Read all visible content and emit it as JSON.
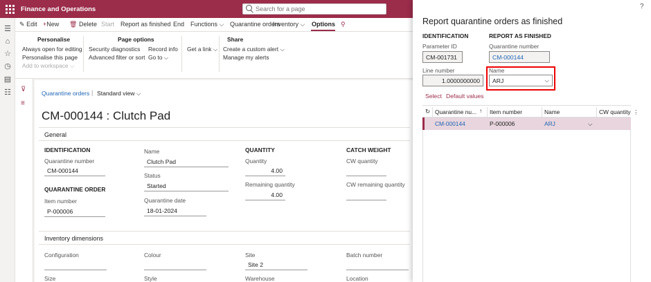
{
  "app": {
    "title": "Finance and Operations",
    "search_placeholder": "Search for a page"
  },
  "actions": {
    "edit": "Edit",
    "new": "New",
    "delete": "Delete",
    "start": "Start",
    "report": "Report as finished",
    "end": "End",
    "functions": "Functions",
    "quarantine_orders": "Quarantine orders",
    "inventory": "Inventory",
    "options": "Options"
  },
  "ribbon": {
    "personalise": {
      "title": "Personalise",
      "items": [
        "Always open for editing",
        "Personalise this page",
        "Add to workspace"
      ]
    },
    "page_options": {
      "title": "Page options",
      "items": [
        "Security diagnostics",
        "Advanced filter or sort",
        "Record info",
        "Go to"
      ]
    },
    "get_link": "Get a link",
    "share": {
      "title": "Share",
      "items": [
        "Create a custom alert",
        "Manage my alerts"
      ]
    }
  },
  "main": {
    "breadcrumb": "Quarantine orders",
    "view": "Standard view",
    "record_title": "CM-000144 : Clutch Pad",
    "general_title": "General",
    "identification": "IDENTIFICATION",
    "quarantine_number_label": "Quarantine number",
    "quarantine_number": "CM-000144",
    "quarantine_order": "QUARANTINE ORDER",
    "item_number_label": "Item number",
    "item_number": "P-000006",
    "name_label": "Name",
    "name": "Clutch Pad",
    "status_label": "Status",
    "status": "Started",
    "quarantine_date_label": "Quarantine date",
    "quarantine_date": "18-01-2024",
    "quantity": "QUANTITY",
    "quantity_label": "Quantity",
    "quantity_value": "4.00",
    "remaining_label": "Remaining quantity",
    "remaining_value": "4.00",
    "catch_weight": "CATCH WEIGHT",
    "cw_quantity_label": "CW quantity",
    "cw_remaining_label": "CW remaining quantity",
    "inv_dims_title": "Inventory dimensions",
    "configuration": "Configuration",
    "colour": "Colour",
    "site": "Site",
    "site_value": "Site 2",
    "batch": "Batch number",
    "size": "Size",
    "style": "Style",
    "warehouse": "Warehouse",
    "location": "Location"
  },
  "panel": {
    "help": "?",
    "title": "Report quarantine orders as finished",
    "identification": "IDENTIFICATION",
    "param_id_label": "Parameter ID",
    "param_id": "CM-001731",
    "line_number_label": "Line number",
    "line_number": "1.0000000000",
    "report_as_finished": "REPORT AS FINISHED",
    "quarantine_number_label": "Quarantine number",
    "quarantine_number": "CM-000144",
    "name_label": "Name",
    "name_value": "ARJ",
    "select": "Select",
    "default_values": "Default values",
    "grid": {
      "headers": [
        "Quarantine nu...",
        "Item number",
        "Name",
        "CW quantity"
      ],
      "row": [
        "CM-000144",
        "P-000006",
        "ARJ",
        ""
      ]
    }
  },
  "colors": {
    "brand": "#9b2c4a",
    "link": "#1e64b4",
    "highlight": "#ee0000"
  }
}
